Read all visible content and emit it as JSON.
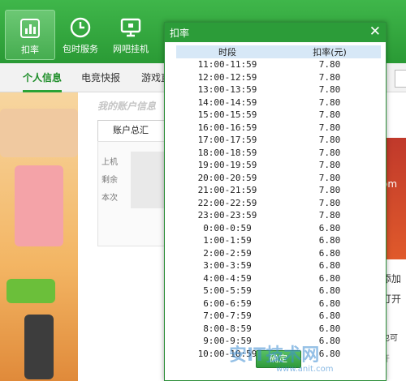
{
  "toolbar": {
    "items": [
      {
        "label": "扣率",
        "icon": "bar-chart-icon",
        "active": true
      },
      {
        "label": "包时服务",
        "icon": "clock-icon",
        "active": false
      },
      {
        "label": "网吧挂机",
        "icon": "monitor-icon",
        "active": false
      }
    ]
  },
  "nav": {
    "tabs": [
      {
        "label": "个人信息",
        "active": true
      },
      {
        "label": "电竞快报",
        "active": false
      },
      {
        "label": "游戏直",
        "active": false
      }
    ]
  },
  "account": {
    "section_title": "我的账户信息",
    "summary_tab": "账户总汇",
    "rows": [
      "上机",
      "剩余",
      "本次"
    ]
  },
  "right_panel": {
    "texts": [
      "om",
      "添加",
      "打开",
      "也可",
      "开"
    ]
  },
  "dialog": {
    "title": "扣率",
    "close_glyph": "✕",
    "columns": [
      "时段",
      "扣率(元)"
    ],
    "rows": [
      {
        "period": "11:00-11:59",
        "rate": "7.80"
      },
      {
        "period": "12:00-12:59",
        "rate": "7.80"
      },
      {
        "period": "13:00-13:59",
        "rate": "7.80"
      },
      {
        "period": "14:00-14:59",
        "rate": "7.80"
      },
      {
        "period": "15:00-15:59",
        "rate": "7.80"
      },
      {
        "period": "16:00-16:59",
        "rate": "7.80"
      },
      {
        "period": "17:00-17:59",
        "rate": "7.80"
      },
      {
        "period": "18:00-18:59",
        "rate": "7.80"
      },
      {
        "period": "19:00-19:59",
        "rate": "7.80"
      },
      {
        "period": "20:00-20:59",
        "rate": "7.80"
      },
      {
        "period": "21:00-21:59",
        "rate": "7.80"
      },
      {
        "period": "22:00-22:59",
        "rate": "7.80"
      },
      {
        "period": "23:00-23:59",
        "rate": "7.80"
      },
      {
        "period": "0:00-0:59",
        "rate": "6.80"
      },
      {
        "period": "1:00-1:59",
        "rate": "6.80"
      },
      {
        "period": "2:00-2:59",
        "rate": "6.80"
      },
      {
        "period": "3:00-3:59",
        "rate": "6.80"
      },
      {
        "period": "4:00-4:59",
        "rate": "6.80"
      },
      {
        "period": "5:00-5:59",
        "rate": "6.80"
      },
      {
        "period": "6:00-6:59",
        "rate": "6.80"
      },
      {
        "period": "7:00-7:59",
        "rate": "6.80"
      },
      {
        "period": "8:00-8:59",
        "rate": "6.80"
      },
      {
        "period": "9:00-9:59",
        "rate": "6.80"
      },
      {
        "period": "10:00-10:59",
        "rate": "6.80"
      }
    ],
    "ok_label": "确定"
  },
  "watermark": {
    "text": "安IT技术网",
    "sub": "www.anit.com"
  },
  "colors": {
    "brand_green": "#2c9c39",
    "table_header": "#d7e8f7"
  }
}
